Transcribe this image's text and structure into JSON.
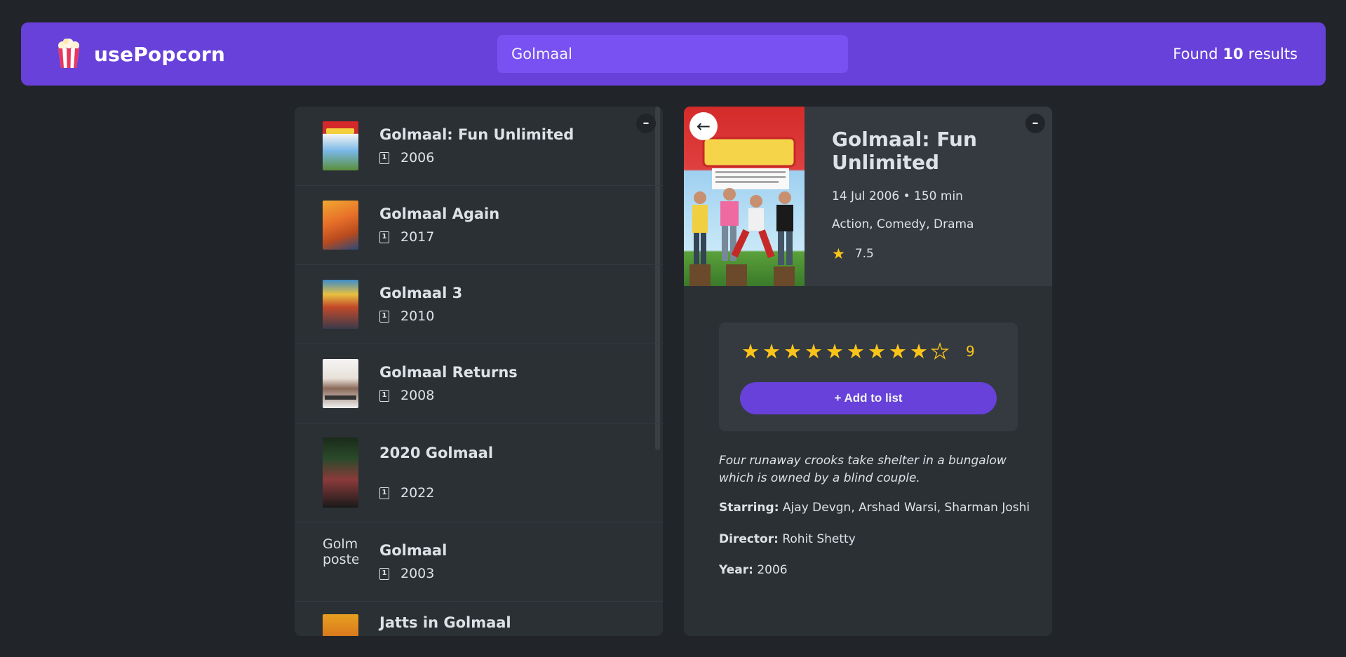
{
  "header": {
    "logo_text": "usePopcorn",
    "logo_icon": "popcorn-icon",
    "search_value": "Golmaal",
    "results_prefix": "Found",
    "results_count": "10",
    "results_suffix": "results"
  },
  "movies": [
    {
      "title": "Golmaal: Fun Unlimited",
      "year": "2006"
    },
    {
      "title": "Golmaal Again",
      "year": "2017"
    },
    {
      "title": "Golmaal 3",
      "year": "2010"
    },
    {
      "title": "Golmaal Returns",
      "year": "2008"
    },
    {
      "title": "2020 Golmaal",
      "year": "2022"
    },
    {
      "title": "Golmaal",
      "year": "2003",
      "poster_alt": "Golmaal poster"
    },
    {
      "title": "Jatts in Golmaal",
      "year": ""
    }
  ],
  "toggle_label": "–",
  "details": {
    "back_label": "←",
    "title": "Golmaal: Fun Unlimited",
    "released_runtime": "14 Jul 2006 • 150 min",
    "genre": "Action, Comedy, Drama",
    "imdb_rating": "7.5",
    "user_rating": 9,
    "user_rating_label": "9",
    "max_rating": 10,
    "add_button_label": "+ Add to list",
    "plot": "Four runaway crooks take shelter in a bungalow which is owned by a blind couple.",
    "starring_label": "Starring:",
    "starring": "Ajay Devgn, Arshad Warsi, Sharman Joshi",
    "director_label": "Director:",
    "director": "Rohit Shetty",
    "year_label": "Year:",
    "year": "2006"
  },
  "colors": {
    "primary": "#6741d9",
    "primary_light": "#7950f2",
    "star": "#fcc419",
    "background": "#212529"
  }
}
